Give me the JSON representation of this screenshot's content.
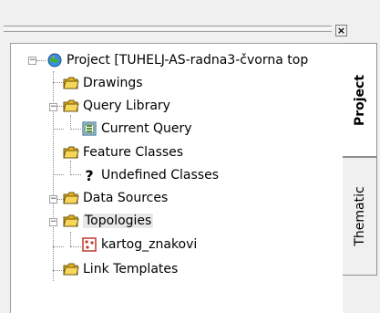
{
  "toolbar": {
    "close_glyph": "×"
  },
  "tree": {
    "root": {
      "label": "Project [TUHELJ-AS-radna3-čvorna top",
      "icon": "globe-icon",
      "expander": "−"
    },
    "items": [
      {
        "label": "Drawings",
        "icon": "folder-icon"
      },
      {
        "label": "Query Library",
        "icon": "folder-icon",
        "expander": "−"
      },
      {
        "label": "Current Query",
        "icon": "query-icon"
      },
      {
        "label": "Feature Classes",
        "icon": "folder-icon",
        "expander": "−"
      },
      {
        "label": "Undefined Classes",
        "icon": "question-icon"
      },
      {
        "label": "Data Sources",
        "icon": "folder-icon"
      },
      {
        "label": "Topologies",
        "icon": "folder-icon",
        "expander": "−"
      },
      {
        "label": "kartog_znakovi",
        "icon": "topology-icon"
      },
      {
        "label": "Link Templates",
        "icon": "folder-icon"
      }
    ]
  },
  "tabs": [
    {
      "label": "Project",
      "active": true
    },
    {
      "label": "Thematic",
      "active": false
    }
  ]
}
